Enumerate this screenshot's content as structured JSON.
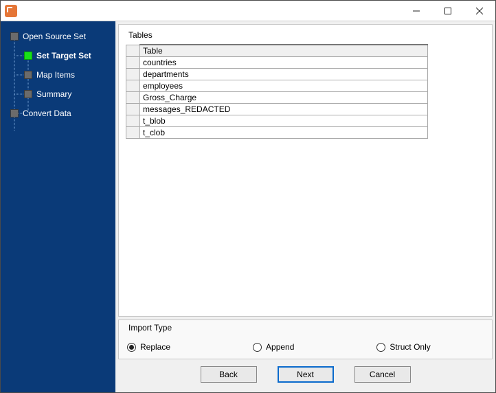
{
  "window": {
    "title": ""
  },
  "sidebar": {
    "items": [
      {
        "label": "Open Source Set",
        "level": 0,
        "active": false
      },
      {
        "label": "Set Target Set",
        "level": 1,
        "active": true
      },
      {
        "label": "Map Items",
        "level": 1,
        "active": false
      },
      {
        "label": "Summary",
        "level": 1,
        "active": false
      },
      {
        "label": "Convert Data",
        "level": 0,
        "active": false
      }
    ]
  },
  "tables_section": {
    "title": "Tables",
    "column_header": "Table",
    "rows": [
      "countries",
      "departments",
      "employees",
      "Gross_Charge",
      "messages_REDACTED",
      "t_blob",
      "t_clob"
    ]
  },
  "import_type": {
    "title": "Import Type",
    "options": [
      {
        "label": "Replace",
        "checked": true
      },
      {
        "label": "Append",
        "checked": false
      },
      {
        "label": "Struct Only",
        "checked": false
      }
    ]
  },
  "buttons": {
    "back": "Back",
    "next": "Next",
    "cancel": "Cancel"
  }
}
